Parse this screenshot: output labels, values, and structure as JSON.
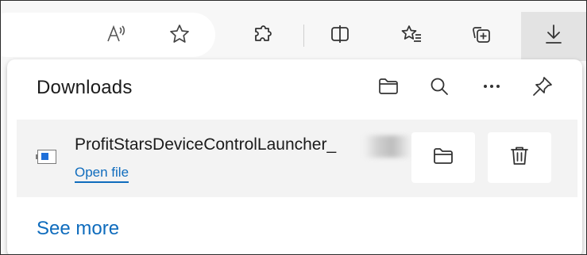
{
  "toolbar": {
    "read_aloud_icon": "read-aloud-icon",
    "favorite_icon": "star-icon",
    "extensions_icon": "puzzle-icon",
    "split_screen_icon": "split-screen-icon",
    "favorites_icon": "favorites-list-icon",
    "collections_icon": "collections-icon",
    "downloads_icon": "download-icon"
  },
  "downloads_panel": {
    "title": "Downloads",
    "header_icons": [
      "open-folder-icon",
      "search-icon",
      "more-icon",
      "pin-icon"
    ],
    "items": [
      {
        "file_name": "ProfitStarsDeviceControlLauncher_",
        "action_label": "Open file",
        "icons": [
          "show-in-folder-icon",
          "delete-icon"
        ]
      }
    ],
    "see_more_label": "See more"
  },
  "colors": {
    "link": "#0f6cbd",
    "panel_bg": "#ffffff",
    "item_bg": "#f3f3f3",
    "toolbar_bg": "#f7f7f7",
    "active_button_bg": "#e3e3e3",
    "file_icon_blue": "#1e6fd9"
  }
}
